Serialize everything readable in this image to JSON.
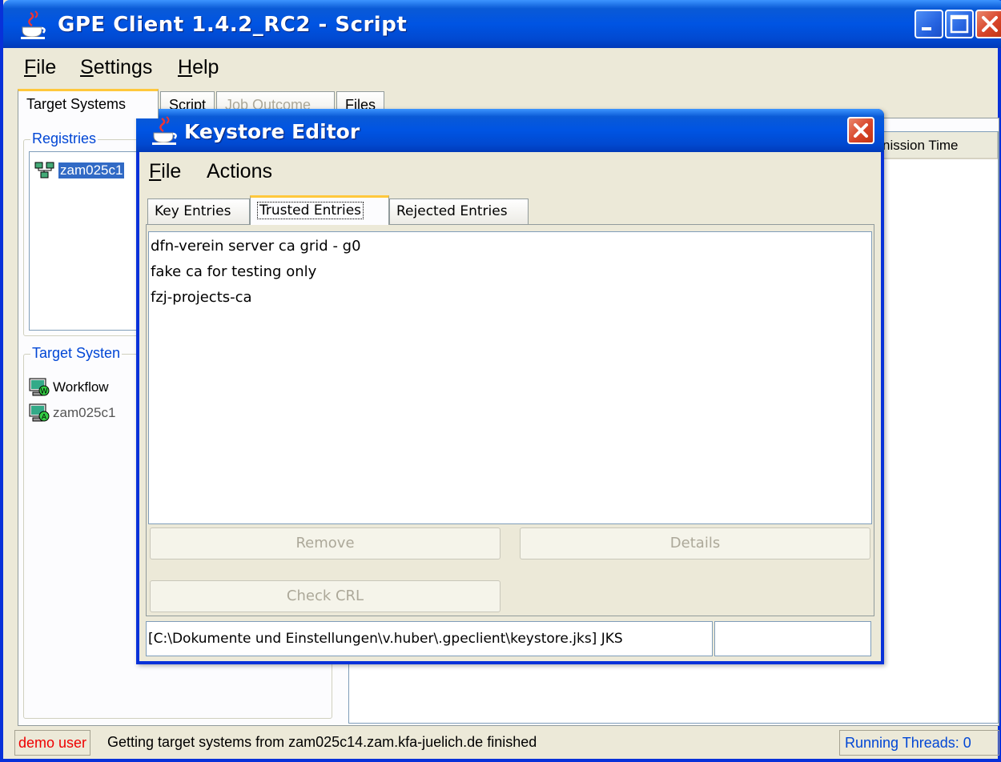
{
  "window": {
    "title": "GPE Client 1.4.2_RC2 - Script"
  },
  "menubar": {
    "items": [
      {
        "mnemonic": "F",
        "rest": "ile"
      },
      {
        "mnemonic": "S",
        "rest": "ettings"
      },
      {
        "mnemonic": "H",
        "rest": "elp"
      }
    ]
  },
  "main_tabs": [
    "Target Systems",
    "Script",
    "Job Outcome",
    "Files"
  ],
  "registries": {
    "title": "Registries",
    "items": [
      {
        "label": "zam025c1"
      }
    ]
  },
  "target_systems": {
    "title": "Target Systen",
    "items": [
      {
        "label": "Workflow"
      },
      {
        "label": "zam025c1"
      }
    ]
  },
  "table": {
    "column_fragment": "nission Time"
  },
  "statusbar": {
    "user": "demo user",
    "message": "Getting target systems from zam025c14.zam.kfa-juelich.de finished",
    "threads": "Running Threads: 0"
  },
  "dialog": {
    "title": "Keystore Editor",
    "menu": [
      {
        "mnemonic": "F",
        "rest": "ile"
      },
      {
        "mnemonic": "",
        "rest": "Actions"
      }
    ],
    "tabs": [
      "Key Entries",
      "Trusted Entries",
      "Rejected Entries"
    ],
    "entries": [
      "dfn-verein server ca grid - g0",
      "fake ca for testing only",
      "fzj-projects-ca"
    ],
    "buttons": {
      "remove": "Remove",
      "details": "Details",
      "check_crl": "Check CRL"
    },
    "path": "[C:\\Dokumente und Einstellungen\\v.huber\\.gpeclient\\keystore.jks] JKS"
  },
  "colors": {
    "title_blue": "#0054e3",
    "accent_orange": "#ffc83c",
    "status_user_red": "#e00000",
    "group_title_blue": "#0046d5"
  },
  "icons": [
    "java-cup-icon",
    "minimize-icon",
    "maximize-icon",
    "close-icon",
    "registry-network-icon",
    "workflow-system-icon",
    "app-system-icon"
  ]
}
